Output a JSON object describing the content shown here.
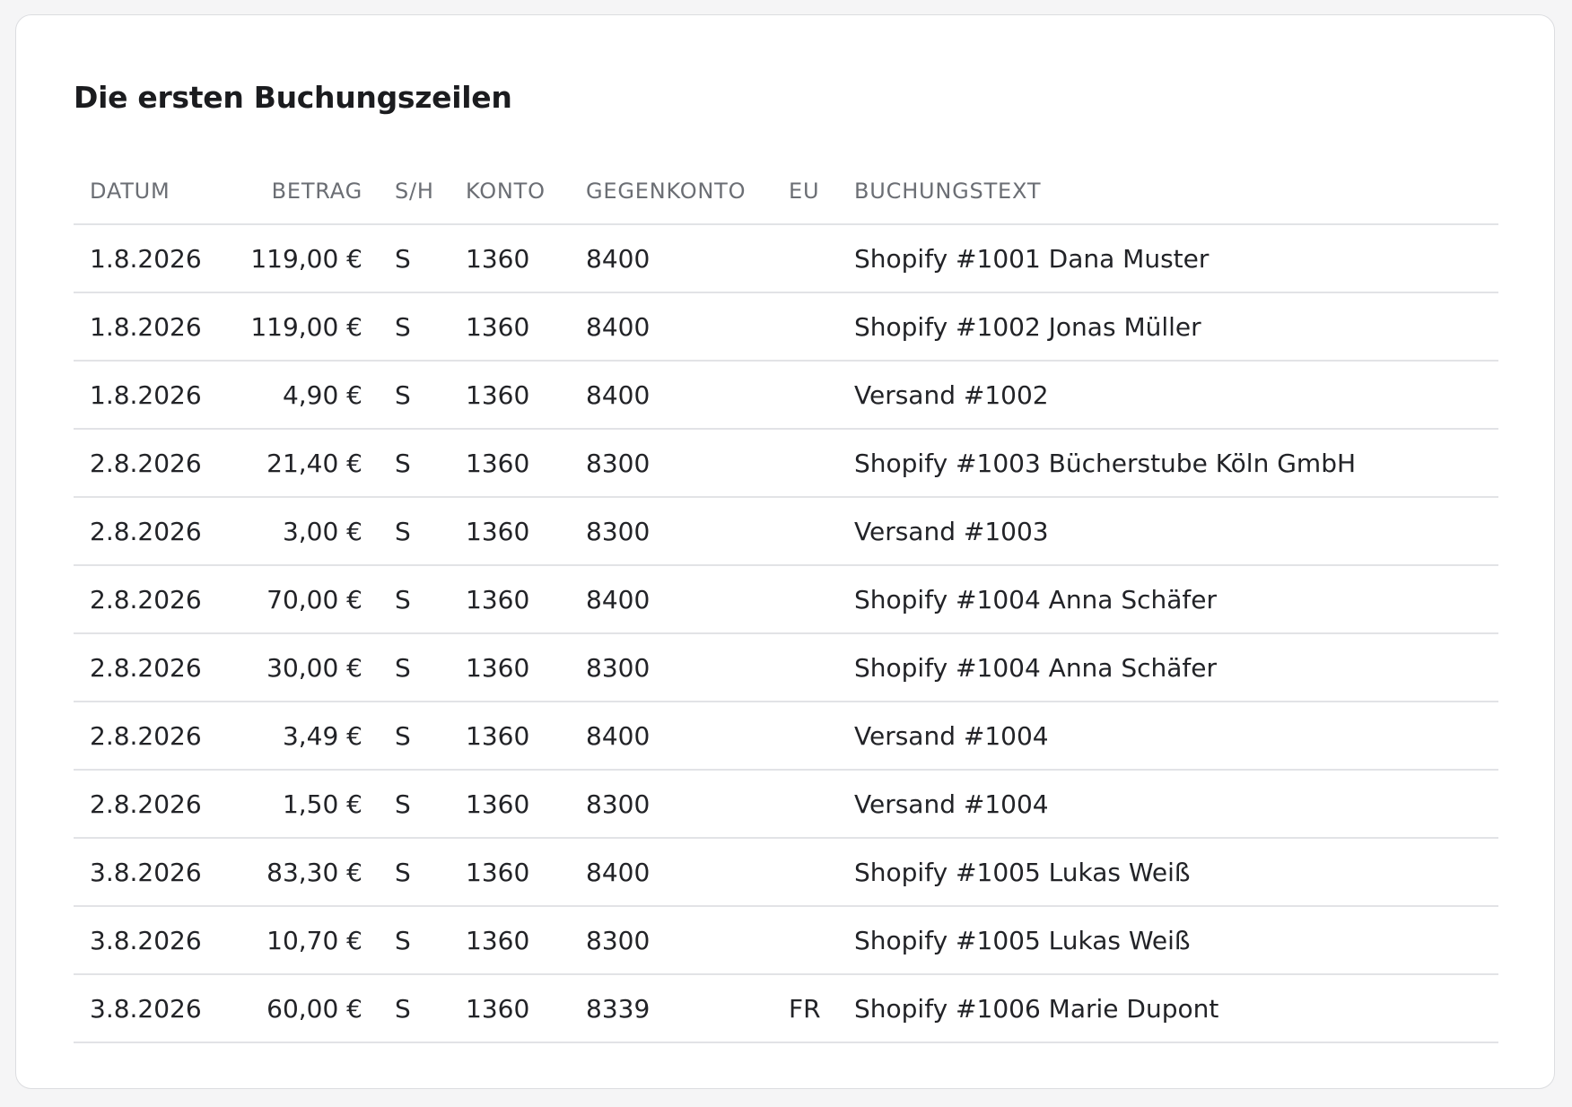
{
  "title": "Die ersten Buchungszeilen",
  "columns": [
    "DATUM",
    "BETRAG",
    "S/H",
    "KONTO",
    "GEGENKONTO",
    "EU",
    "BUCHUNGSTEXT"
  ],
  "rows": [
    [
      "1.8.2026",
      "119,00 €",
      "S",
      "1360",
      "8400",
      "",
      "Shopify #1001 Dana Muster"
    ],
    [
      "1.8.2026",
      "119,00 €",
      "S",
      "1360",
      "8400",
      "",
      "Shopify #1002 Jonas Müller"
    ],
    [
      "1.8.2026",
      "4,90 €",
      "S",
      "1360",
      "8400",
      "",
      "Versand #1002"
    ],
    [
      "2.8.2026",
      "21,40 €",
      "S",
      "1360",
      "8300",
      "",
      "Shopify #1003 Bücherstube Köln GmbH"
    ],
    [
      "2.8.2026",
      "3,00 €",
      "S",
      "1360",
      "8300",
      "",
      "Versand #1003"
    ],
    [
      "2.8.2026",
      "70,00 €",
      "S",
      "1360",
      "8400",
      "",
      "Shopify #1004 Anna Schäfer"
    ],
    [
      "2.8.2026",
      "30,00 €",
      "S",
      "1360",
      "8300",
      "",
      "Shopify #1004 Anna Schäfer"
    ],
    [
      "2.8.2026",
      "3,49 €",
      "S",
      "1360",
      "8400",
      "",
      "Versand #1004"
    ],
    [
      "2.8.2026",
      "1,50 €",
      "S",
      "1360",
      "8300",
      "",
      "Versand #1004"
    ],
    [
      "3.8.2026",
      "83,30 €",
      "S",
      "1360",
      "8400",
      "",
      "Shopify #1005 Lukas Weiß"
    ],
    [
      "3.8.2026",
      "10,70 €",
      "S",
      "1360",
      "8300",
      "",
      "Shopify #1005 Lukas Weiß"
    ],
    [
      "3.8.2026",
      "60,00 €",
      "S",
      "1360",
      "8339",
      "FR",
      "Shopify #1006 Marie Dupont"
    ]
  ]
}
